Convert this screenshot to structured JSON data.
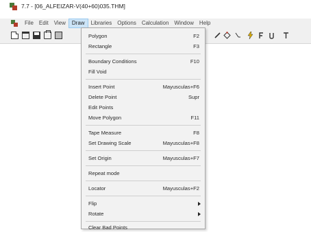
{
  "window": {
    "title": "7.7 - [06_ALFEIZAR-V(40+60)035.THM]"
  },
  "menubar": {
    "items": [
      "File",
      "Edit",
      "View",
      "Draw",
      "Libraries",
      "Options",
      "Calculation",
      "Window",
      "Help"
    ],
    "active": "Draw"
  },
  "toolbar": {
    "icons": [
      "new-document",
      "open-folder",
      "save-disk",
      "print",
      "grid",
      "pencil",
      "diamond-vertex",
      "point-label",
      "lightning",
      "special-f",
      "u-tool",
      "t-tool"
    ]
  },
  "draw_menu": {
    "items": [
      {
        "label": "Polygon",
        "shortcut": "F2"
      },
      {
        "label": "Rectangle",
        "shortcut": "F3"
      },
      {
        "label": "Boundary Conditions",
        "shortcut": "F10"
      },
      {
        "label": "Fill Void",
        "shortcut": ""
      },
      {
        "label": "Insert Point",
        "shortcut": "Mayusculas+F6"
      },
      {
        "label": "Delete Point",
        "shortcut": "Supr"
      },
      {
        "label": "Edit Points",
        "shortcut": ""
      },
      {
        "label": "Move Polygon",
        "shortcut": "F11"
      },
      {
        "label": "Tape Measure",
        "shortcut": "F8"
      },
      {
        "label": "Set Drawing Scale",
        "shortcut": "Mayusculas+F8"
      },
      {
        "label": "Set Origin",
        "shortcut": "Mayusculas+F7"
      },
      {
        "label": "Repeat mode",
        "shortcut": ""
      },
      {
        "label": "Locator",
        "shortcut": "Mayusculas+F2"
      },
      {
        "label": "Flip",
        "shortcut": ""
      },
      {
        "label": "Rotate",
        "shortcut": ""
      },
      {
        "label": "Clear Bad Points",
        "shortcut": ""
      }
    ]
  }
}
